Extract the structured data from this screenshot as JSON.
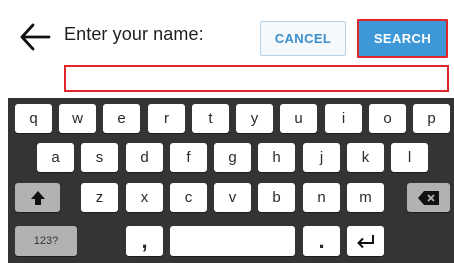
{
  "header": {
    "back_icon": "arrow-left-icon",
    "prompt": "Enter your name:",
    "cancel_label": "CANCEL",
    "search_label": "SEARCH"
  },
  "name_field": {
    "value": "",
    "placeholder": ""
  },
  "keyboard": {
    "rows": [
      [
        "q",
        "w",
        "e",
        "r",
        "t",
        "y",
        "u",
        "i",
        "o",
        "p"
      ],
      [
        "a",
        "s",
        "d",
        "f",
        "g",
        "h",
        "j",
        "k",
        "l"
      ],
      [
        "z",
        "x",
        "c",
        "v",
        "b",
        "n",
        "m"
      ]
    ],
    "shift_icon": "shift-up-arrow-icon",
    "backspace_icon": "backspace-icon",
    "symbols_label": "123?",
    "comma_label": ",",
    "period_label": ".",
    "enter_icon": "enter-return-icon"
  },
  "colors": {
    "accent_blue": "#3e98d8",
    "highlight_red": "#e0262a",
    "keyboard_background": "#343434",
    "letter_key": "#ffffff",
    "function_key": "#b2b2b2"
  }
}
